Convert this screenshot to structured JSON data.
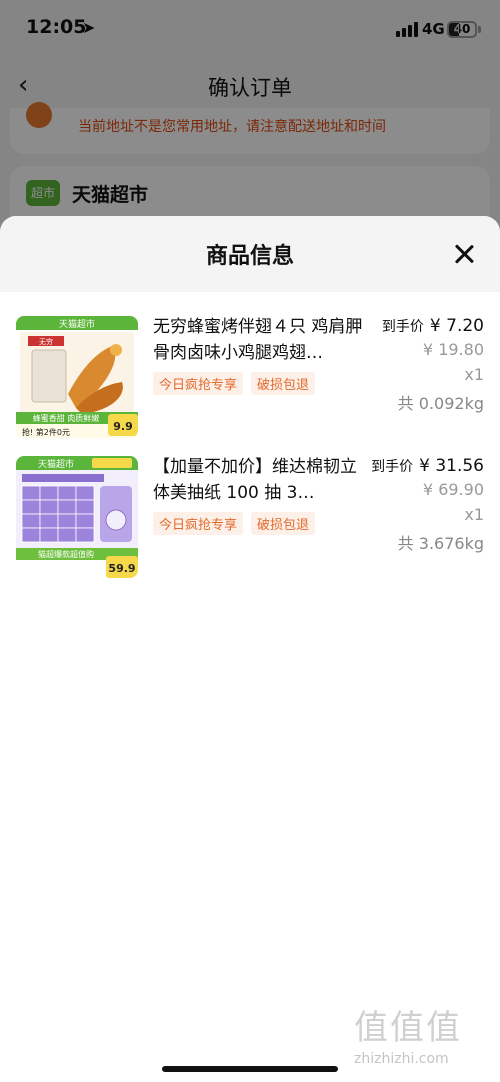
{
  "status_bar": {
    "time": "12:05",
    "network": "4G",
    "battery": "40"
  },
  "nav": {
    "back": "‹",
    "title": "确认订单"
  },
  "address_warning": "当前地址不是您常用地址，请注意配送地址和时间",
  "store": {
    "logo_text": "超市",
    "name": "天猫超市"
  },
  "sheet": {
    "title": "商品信息"
  },
  "items": [
    {
      "name": "无穷蜂蜜烤伴翅４只 鸡肩胛骨肉卤味小鸡腿鸡翅…",
      "tags": [
        "今日疯抢专享",
        "破损包退"
      ],
      "price_label": "到手价",
      "price": "¥ 7.20",
      "original_price": "¥ 19.80",
      "quantity": "x1",
      "weight": "共 0.092kg",
      "thumb": {
        "banner": "天猫超市",
        "brand": "无穷",
        "slogan": "蜂蜜香甜 肉质鲜嫩",
        "promo": "抢! 第2件0元",
        "price": "9.9"
      }
    },
    {
      "name": "【加量不加价】维达棉韧立体美抽纸 100 抽 3…",
      "tags": [
        "今日疯抢专享",
        "破损包退"
      ],
      "price_label": "到手价",
      "price": "¥ 31.56",
      "original_price": "¥ 69.90",
      "quantity": "x1",
      "weight": "共 3.676kg",
      "thumb": {
        "banner": "天猫超市",
        "promo": "猫超爆款超值购",
        "price": "59.9"
      }
    }
  ],
  "watermark": {
    "chars": "值值值",
    "url": "zhizhizhi.com"
  },
  "colors": {
    "accent": "#e26a2c",
    "tag_bg": "#fdf0e8",
    "green": "#5bb53a",
    "purple": "#8b6fd0"
  }
}
